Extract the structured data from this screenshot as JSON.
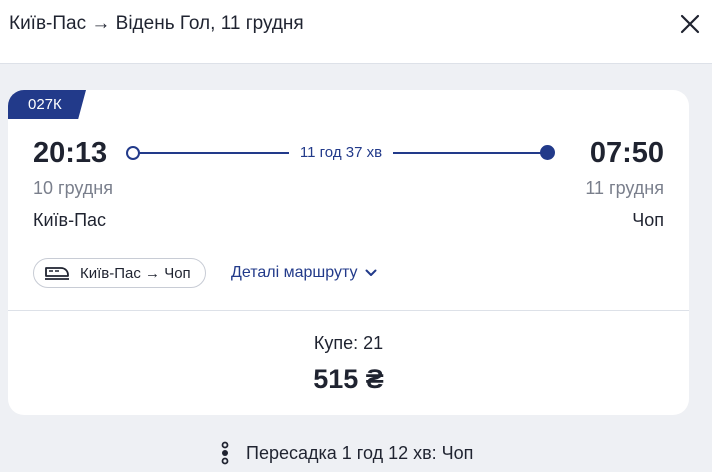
{
  "header": {
    "title": "Київ-Пас → Відень Гол, 11 грудня"
  },
  "card": {
    "train_number": "027К",
    "departure": {
      "time": "20:13",
      "date": "10 грудня",
      "station": "Київ-Пас"
    },
    "arrival": {
      "time": "07:50",
      "date": "11 грудня",
      "station": "Чоп"
    },
    "duration": "11 год 37 хв",
    "segment": "Київ-Пас → Чоп",
    "details_label": "Деталі маршруту",
    "seat_class": "Купе: 21",
    "price": "515 ₴"
  },
  "transfer": {
    "label": "Пересадка 1 год 12 хв: Чоп"
  },
  "colors": {
    "accent": "#223a8a",
    "background": "#eef0f4",
    "muted_text": "#7a7f8c"
  },
  "icons": [
    "close-icon",
    "train-icon",
    "chevron-down-icon",
    "transfer-icon"
  ]
}
